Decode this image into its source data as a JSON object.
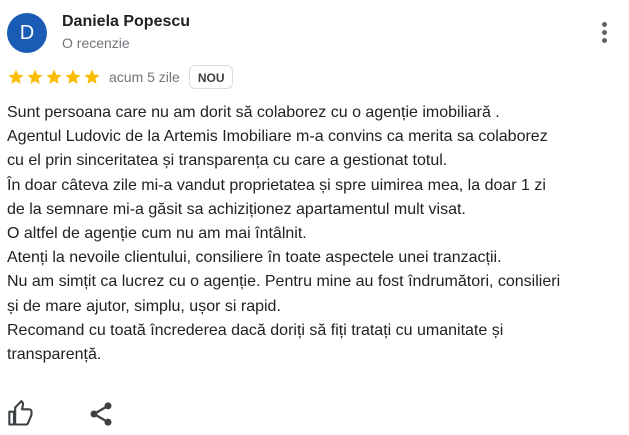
{
  "review": {
    "author": {
      "initial": "D",
      "name": "Daniela Popescu",
      "meta": "O recenzie"
    },
    "rating": 5,
    "date": "acum 5 zile",
    "badge": "NOU",
    "text_lines": [
      "Sunt persoana care nu am dorit să colaborez cu o agenție imobiliară .",
      "Agentul Ludovic de la Artemis Imobiliare m-a convins ca merita sa colaborez",
      "cu el prin sinceritatea și transparența cu care a gestionat totul.",
      "În doar câteva zile mi-a vandut proprietatea și spre uimirea mea, la doar 1 zi",
      "de la semnare mi-a găsit sa achiziționez apartamentul mult visat.",
      "O altfel de agenție cum nu am mai întâlnit.",
      "Atenți la nevoile clientului, consiliere în toate aspectele unei tranzacții.",
      "Nu am simțit ca lucrez cu o agenție. Pentru mine au fost îndrumători, consilieri",
      "și de mare ajutor, simplu, ușor si rapid.",
      "Recomand cu toată încrederea dacă doriți să fiți tratați cu umanitate și",
      "transparență."
    ]
  },
  "icons": {
    "more": "more-vert-icon",
    "star": "star-icon",
    "like": "thumb-up-icon",
    "share": "share-icon"
  },
  "colors": {
    "avatar_bg": "#1a5bb5",
    "star": "#fbbc04",
    "muted_text": "#70757a",
    "icon": "#5f6368"
  }
}
